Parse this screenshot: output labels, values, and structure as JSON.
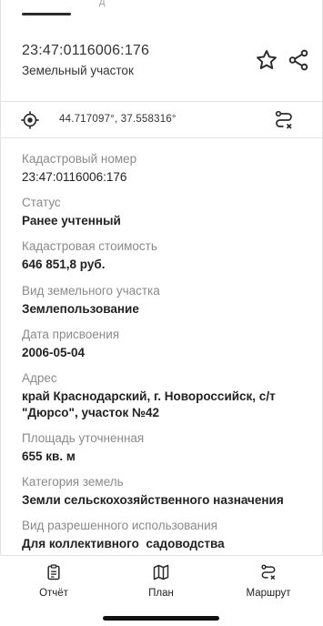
{
  "top_tab": {
    "fragment": "д"
  },
  "header": {
    "title": "23:47:0116006:176",
    "subtitle": "Земельный участок",
    "icons": {
      "favorite": "star-icon",
      "share": "share-icon"
    }
  },
  "coordinates": {
    "text": "44.717097°, 37.558316°",
    "icons": {
      "locate": "crosshair-icon",
      "route": "route-icon"
    }
  },
  "details": {
    "fields": [
      {
        "label": "Кадастровый номер",
        "value": "23:47:0116006:176"
      },
      {
        "label": "Статус",
        "value": "Ранее учтенный"
      },
      {
        "label": "Кадастровая стоимость",
        "value": "646 851,8 руб."
      },
      {
        "label": "Вид земельного участка",
        "value": "Землепользование"
      },
      {
        "label": "Дата присвоения",
        "value": "2006-05-04"
      },
      {
        "label": "Адрес",
        "value": "край Краснодарский, г. Новороссийск, с/т \"Дюрсо\", участок №42"
      },
      {
        "label": "Площадь уточненная",
        "value": "655 кв. м"
      },
      {
        "label": "Категория земель",
        "value": "Земли сельскохозяйственного назначения"
      },
      {
        "label": "Вид разрешенного использования",
        "value": "Для коллективного  садоводства"
      }
    ]
  },
  "bottom_nav": {
    "items": [
      {
        "label": "Отчёт",
        "icon": "report-icon"
      },
      {
        "label": "План",
        "icon": "map-icon"
      },
      {
        "label": "Маршрут",
        "icon": "route-icon"
      }
    ]
  },
  "colors": {
    "label_gray": "#8a8a8a",
    "text_dark": "#222222",
    "border": "#e3e3e3"
  }
}
